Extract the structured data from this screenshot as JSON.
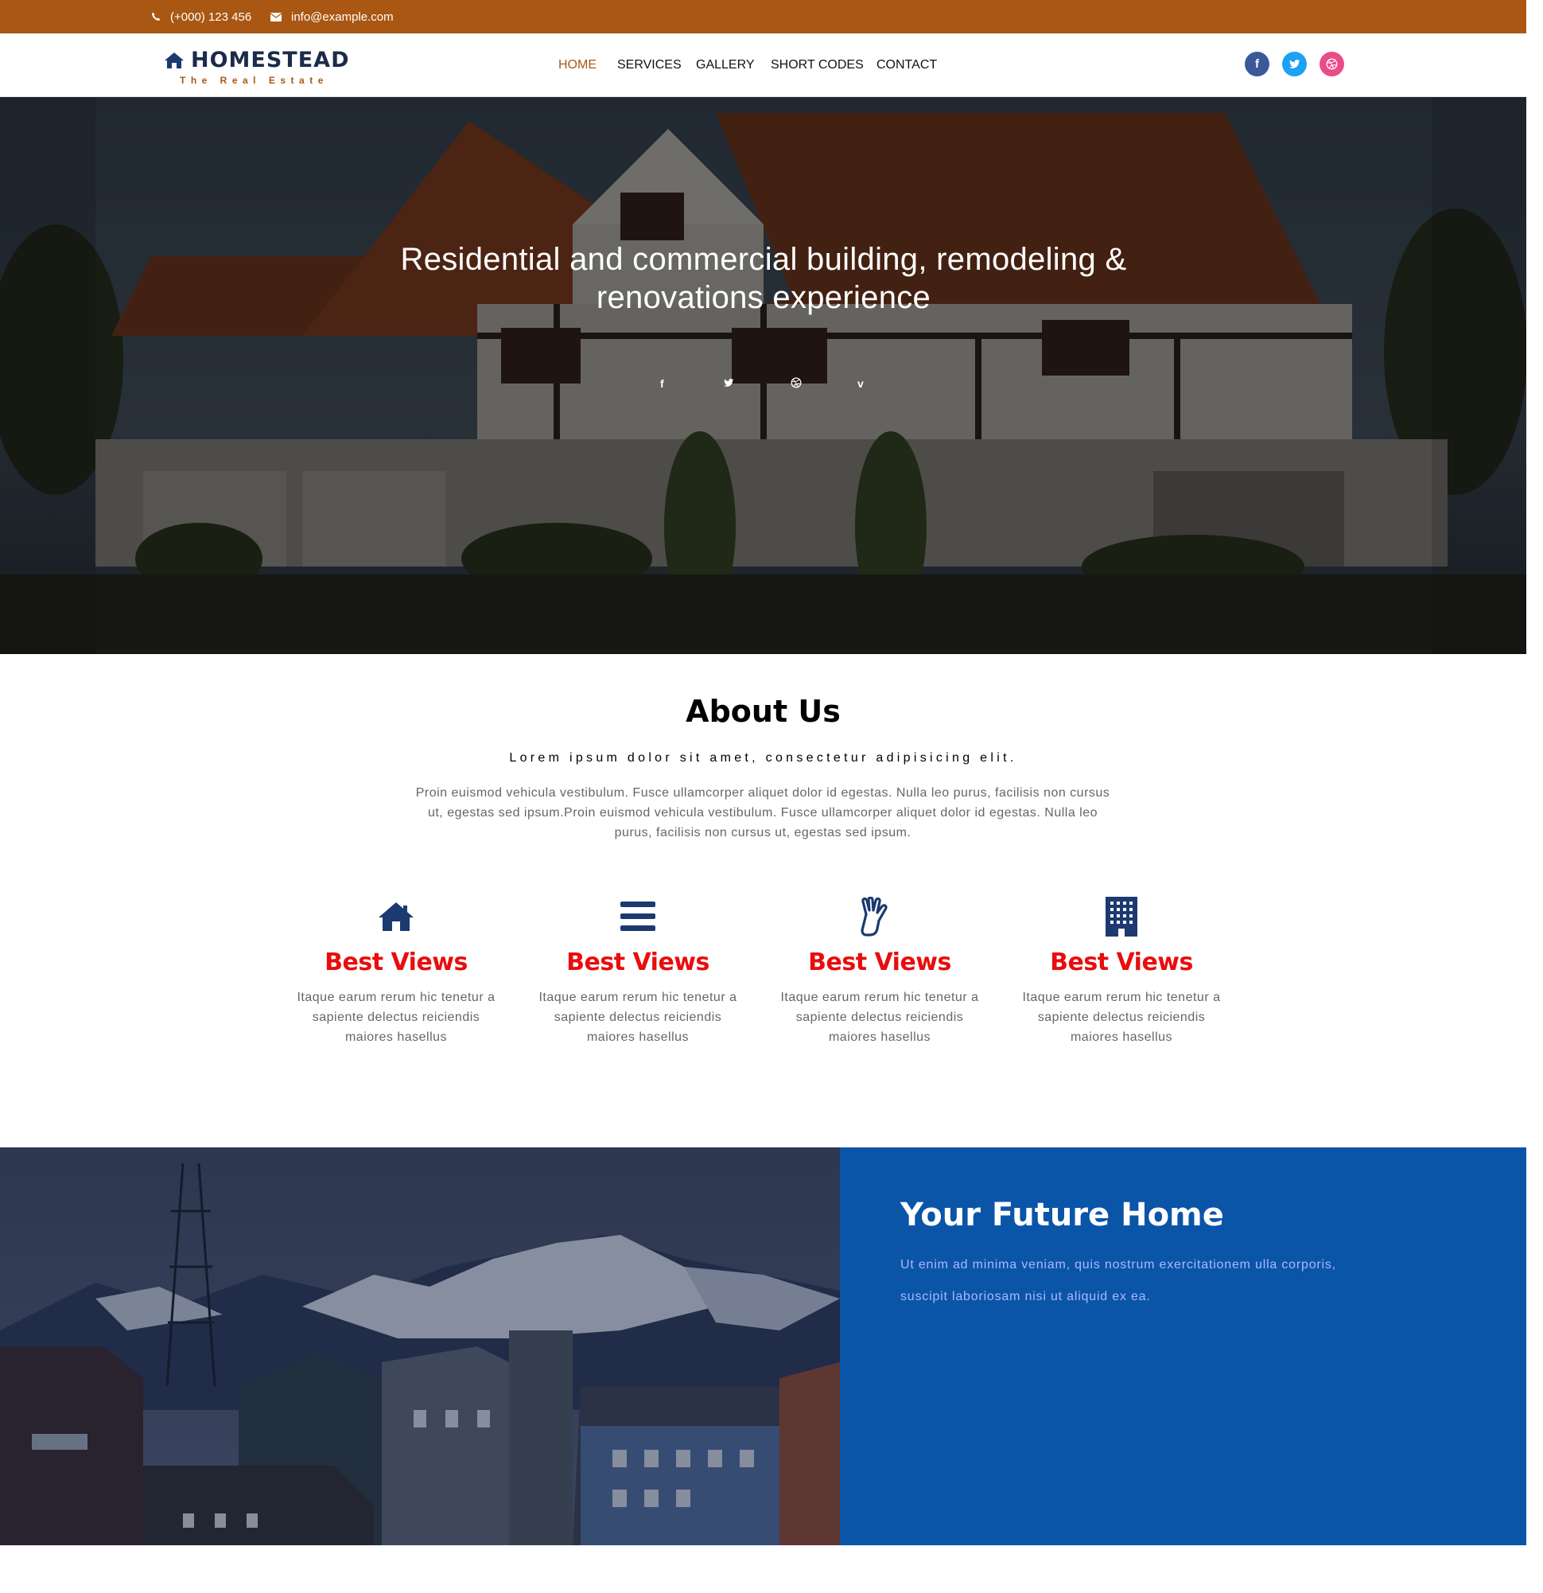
{
  "topbar": {
    "phone": "(+000) 123 456",
    "email": "info@example.com",
    "phone_icon": "phone-icon",
    "email_icon": "envelope-icon",
    "bg_color": "#a95713"
  },
  "logo": {
    "name": "HOMESTEAD",
    "tagline": "The Real Estate",
    "icon": "house-icon"
  },
  "nav": {
    "items": [
      "HOME",
      "SERVICES",
      "GALLERY",
      "SHORT CODES",
      "CONTACT"
    ],
    "active": "HOME",
    "active_color": "#a95713"
  },
  "social_top": [
    {
      "name": "facebook",
      "glyph": "f",
      "color": "#3b5998"
    },
    {
      "name": "twitter",
      "glyph": "t",
      "color": "#1da1f2"
    },
    {
      "name": "dribbble",
      "glyph": "◎",
      "color": "#ea4c89"
    }
  ],
  "hero": {
    "heading_line1": "Residential and commercial building, remodeling &",
    "heading_line2": "renovations experience",
    "social": [
      {
        "name": "facebook",
        "glyph": "f"
      },
      {
        "name": "twitter",
        "glyph": "t"
      },
      {
        "name": "dribbble",
        "glyph": "◎"
      },
      {
        "name": "vimeo",
        "glyph": "v"
      }
    ]
  },
  "about": {
    "title": "About Us",
    "subtitle": "Lorem ipsum dolor sit amet, consectetur adipisicing elit.",
    "body_line1": "Proin euismod vehicula vestibulum. Fusce ullamcorper aliquet dolor id egestas. Nulla leo purus, facilisis non cursus",
    "body_line2": "ut, egestas sed ipsum.Proin euismod vehicula vestibulum. Fusce ullamcorper aliquet dolor id egestas. Nulla leo",
    "body_line3": "purus, facilisis non cursus ut, egestas sed ipsum."
  },
  "features": [
    {
      "icon": "home-icon",
      "title": "Best Views",
      "line1": "Itaque earum rerum hic tenetur a",
      "line2": "sapiente delectus reiciendis",
      "line3": "maiores hasellus"
    },
    {
      "icon": "bars-icon",
      "title": "Best Views",
      "line1": "Itaque earum rerum hic tenetur a",
      "line2": "sapiente delectus reiciendis",
      "line3": "maiores hasellus"
    },
    {
      "icon": "hand-icon",
      "title": "Best Views",
      "line1": "Itaque earum rerum hic tenetur a",
      "line2": "sapiente delectus reiciendis",
      "line3": "maiores hasellus"
    },
    {
      "icon": "building-icon",
      "title": "Best Views",
      "line1": "Itaque earum rerum hic tenetur a",
      "line2": "sapiente delectus reiciendis",
      "line3": "maiores hasellus"
    }
  ],
  "future": {
    "title": "Your Future Home",
    "line1": "Ut enim ad minima veniam, quis nostrum exercitationem ulla corporis,",
    "line2": "suscipit laboriosam nisi ut aliquid ex ea.",
    "panel_color": "#0b55a8"
  },
  "colors": {
    "feature_title": "#e90d0d",
    "icon_navy": "#1c3a70"
  }
}
